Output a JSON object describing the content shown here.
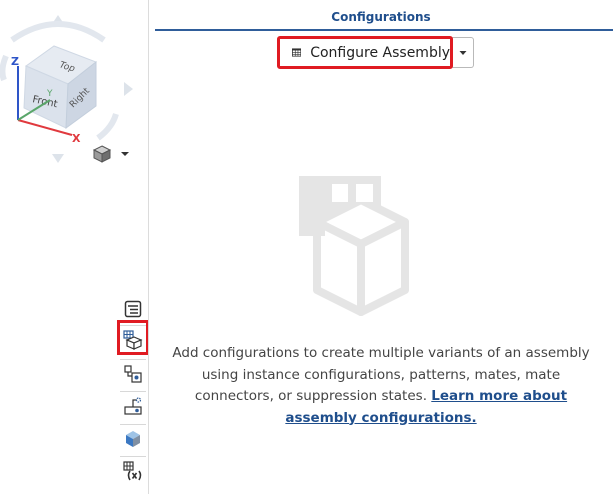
{
  "viewcube": {
    "face_front": "Front",
    "face_top": "Top",
    "face_right": "Right",
    "axis_x": "X",
    "axis_y": "Y",
    "axis_z": "Z",
    "icons": {
      "dropdown": "chevron-down-icon",
      "cube": "cube-icon"
    },
    "colors": {
      "x_axis": "#e0393e",
      "y_axis": "#5aa66a",
      "z_axis": "#2e55c8",
      "cube": "#c8d4e3"
    }
  },
  "toolbar": {
    "items": [
      {
        "icon": "features-list-icon"
      },
      {
        "icon": "configurations-icon",
        "highlighted": true
      },
      {
        "icon": "mate-connector-icon"
      },
      {
        "icon": "bom-icon"
      },
      {
        "icon": "appearance-icon"
      },
      {
        "icon": "variable-icon"
      }
    ]
  },
  "panel": {
    "title": "Configurations",
    "configure_button_label": "Configure Assembly",
    "configure_button_icon": "table-icon",
    "dropdown_icon": "chevron-down-icon",
    "empty_state_icon": "configurations-empty-icon",
    "empty_text": "Add configurations to create multiple variants of an assembly using instance configurations, patterns, mates, mate connectors, or suppression states.",
    "learn_more_link": "Learn more about assembly configurations.",
    "accent_color": "#1f4e8c",
    "highlight_color": "#e01b22"
  }
}
